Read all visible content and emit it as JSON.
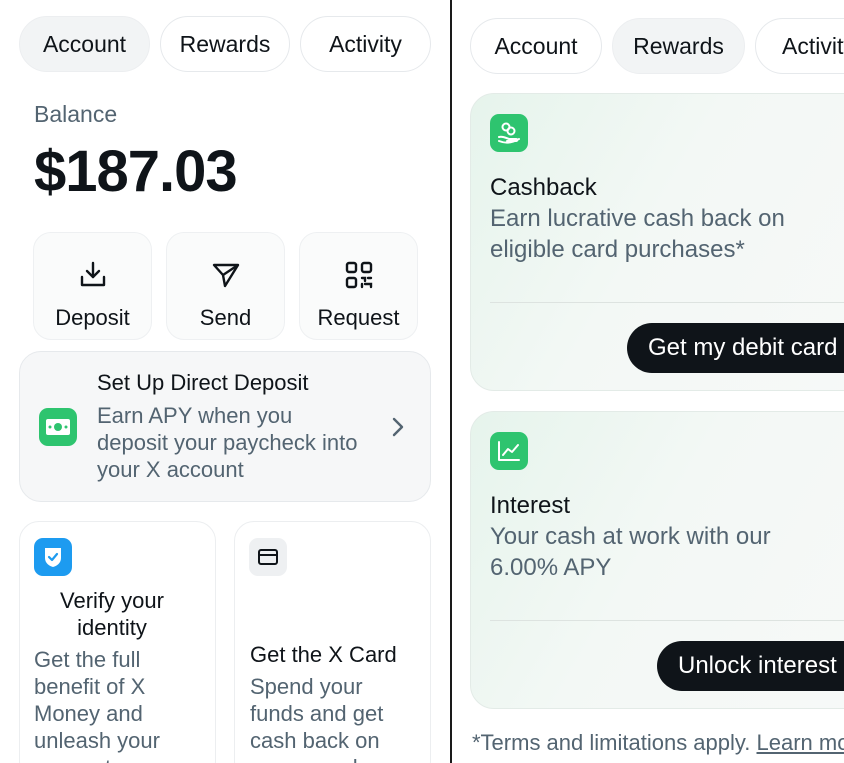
{
  "left": {
    "tabs": [
      {
        "label": "Account",
        "active": true
      },
      {
        "label": "Rewards",
        "active": false
      },
      {
        "label": "Activity",
        "active": false
      }
    ],
    "balance": {
      "label": "Balance",
      "value": "$187.03"
    },
    "actions": [
      {
        "label": "Deposit",
        "icon": "download-icon"
      },
      {
        "label": "Send",
        "icon": "send-icon"
      },
      {
        "label": "Request",
        "icon": "qr-code-icon"
      }
    ],
    "direct_deposit": {
      "title": "Set Up Direct Deposit",
      "description": "Earn APY when you deposit your paycheck into your X account",
      "icon": "cash-icon"
    },
    "verify_card": {
      "title": "Verify your identity",
      "description": "Get the full benefit of X Money and unleash your account",
      "icon": "shield-check-icon"
    },
    "x_card": {
      "title": "Get the X Card",
      "description": "Spend your funds and get cash back on every purchase",
      "icon": "credit-card-icon"
    }
  },
  "right": {
    "tabs": [
      {
        "label": "Account",
        "active": false
      },
      {
        "label": "Rewards",
        "active": true
      },
      {
        "label": "Activity",
        "active": false
      }
    ],
    "cashback": {
      "title": "Cashback",
      "description": "Earn lucrative cash back on eligible card purchases*",
      "button": "Get my debit card",
      "icon": "coins-hand-icon"
    },
    "interest": {
      "title": "Interest",
      "description": "Your cash at work with our 6.00% APY",
      "button": "Unlock interest",
      "icon": "chart-icon"
    },
    "footnote": {
      "text": "*Terms and limitations apply.",
      "link": "Learn more"
    }
  },
  "colors": {
    "accent_green": "#2ec46f",
    "verify_blue": "#1d9bf0",
    "dark_button": "#0f1419",
    "muted_text": "#536471"
  }
}
